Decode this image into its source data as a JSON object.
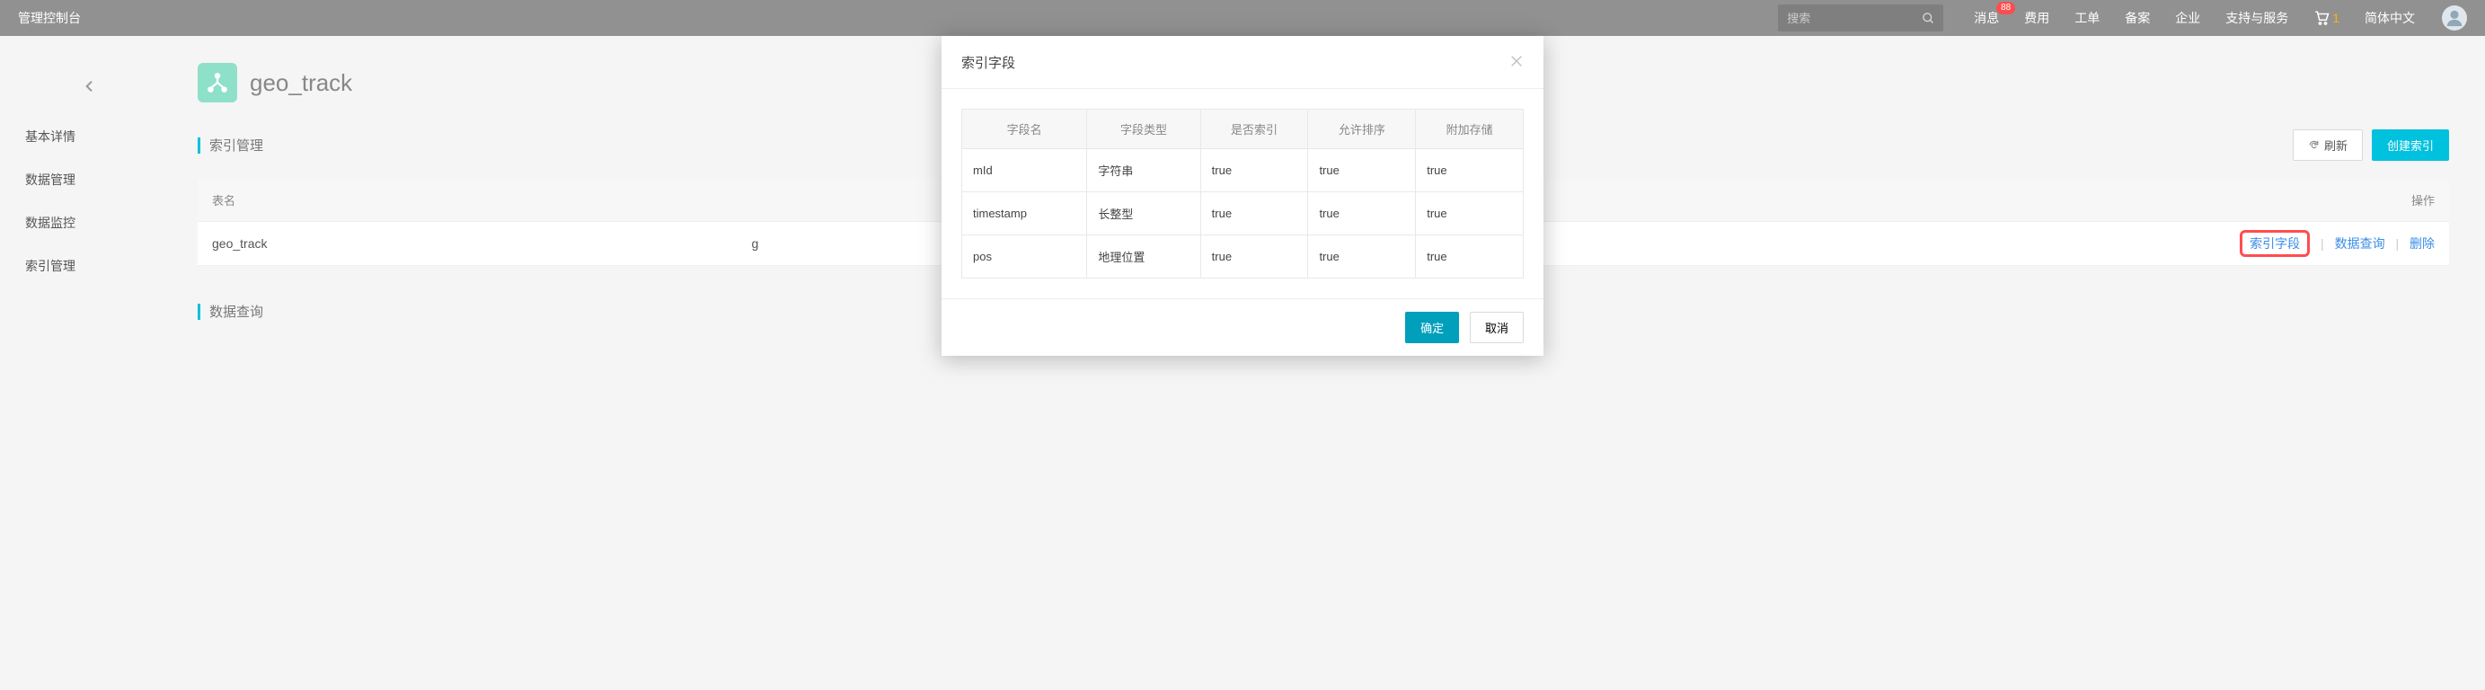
{
  "topbar": {
    "title": "管理控制台",
    "search_placeholder": "搜索",
    "links": {
      "messages": "消息",
      "messages_badge": "88",
      "billing": "费用",
      "tickets": "工单",
      "filing": "备案",
      "enterprise": "企业",
      "support": "支持与服务",
      "language": "简体中文"
    },
    "cart_count": "1"
  },
  "sidebar": {
    "items": [
      {
        "label": "基本详情"
      },
      {
        "label": "数据管理"
      },
      {
        "label": "数据监控"
      },
      {
        "label": "索引管理"
      }
    ]
  },
  "page": {
    "title": "geo_track"
  },
  "section": {
    "index_mgmt": "索引管理",
    "data_query": "数据查询",
    "refresh": "刷新",
    "create_index": "创建索引"
  },
  "main_table": {
    "headers": {
      "name": "表名",
      "actions": "操作"
    },
    "row": {
      "name": "geo_track",
      "truncated": "g",
      "action_index_fields": "索引字段",
      "action_data_query": "数据查询",
      "action_delete": "删除"
    }
  },
  "modal": {
    "title": "索引字段",
    "headers": {
      "field_name": "字段名",
      "field_type": "字段类型",
      "indexed": "是否索引",
      "sortable": "允许排序",
      "stored": "附加存储"
    },
    "rows": [
      {
        "name": "mId",
        "type": "字符串",
        "indexed": "true",
        "sortable": "true",
        "stored": "true"
      },
      {
        "name": "timestamp",
        "type": "长整型",
        "indexed": "true",
        "sortable": "true",
        "stored": "true"
      },
      {
        "name": "pos",
        "type": "地理位置",
        "indexed": "true",
        "sortable": "true",
        "stored": "true"
      }
    ],
    "confirm": "确定",
    "cancel": "取消"
  }
}
